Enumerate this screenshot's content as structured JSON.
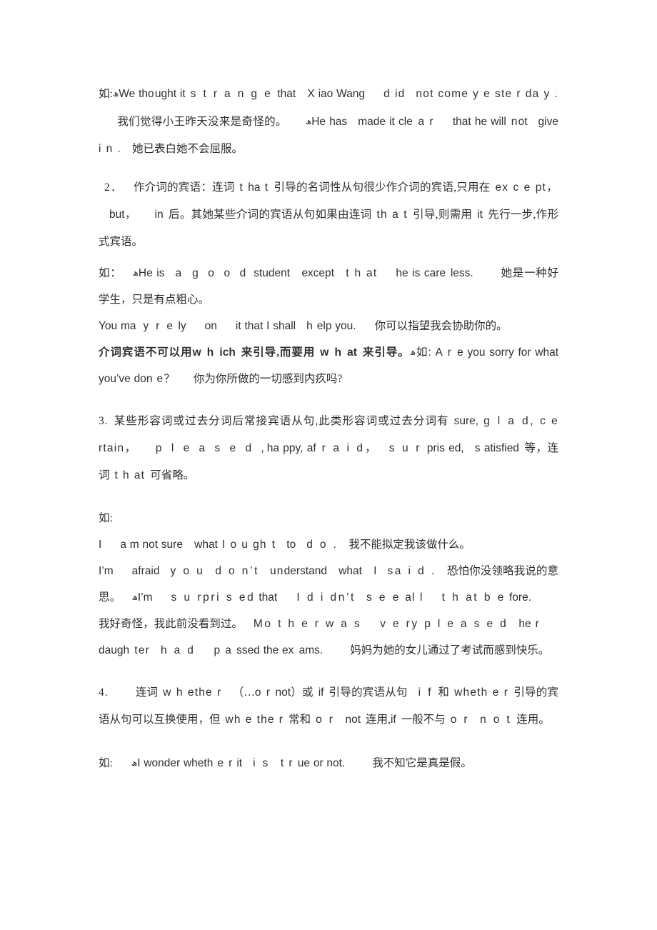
{
  "document": {
    "language": "zh-CN / en",
    "page_background": "#ffffff",
    "text_color": "#2f2f2f",
    "marker_glyph": "ھ"
  },
  "blocks": [
    {
      "id": "example-block-1",
      "kind": "example-paragraph",
      "runs": [
        {
          "text": "如:",
          "style": "cjk"
        },
        {
          "text": "ھ",
          "style": "marker"
        },
        {
          "text": "We th",
          "style": "sans"
        },
        {
          "text": "o",
          "style": "sans-track2"
        },
        {
          "text": "ught it",
          "style": "sans"
        },
        {
          "text": "  s t r a n g e ",
          "style": "sans-track3"
        },
        {
          "text": "tha",
          "style": "sans"
        },
        {
          "text": "t",
          "style": "sans-track2"
        },
        {
          "text": "   X iao Wang",
          "style": "sans"
        },
        {
          "text": "    d id    no",
          "style": "sans-track2"
        },
        {
          "text": "t",
          "style": "sans"
        },
        {
          "text": "  come y e ste r da y .",
          "style": "sans-track2"
        },
        {
          "text": "    我们觉得小王昨天没来是奇怪的。",
          "style": "cjk"
        },
        {
          "text": "   ",
          "style": "sans"
        },
        {
          "text": "ھ",
          "style": "marker"
        },
        {
          "text": "He has   made it cl e a r    that he will  n ot   give i n .",
          "style": "sans"
        },
        {
          "text": "   她已表白她不会屈服。",
          "style": "cjk"
        }
      ],
      "plain_text": "如:ھWe thought it strange that Xiao Wang did not come yesterday. 我们觉得小王昨天没来是奇怪的。 ھHe has made it clear that he will not give in. 她已表白她不会屈服。"
    },
    {
      "id": "item-2",
      "kind": "numbered-item",
      "number": "2．",
      "plain_text": "2． 作介词的宾语：连词 that 引导的名词性从句很少作介词的宾语,只用在 except, but, in 后。其她某些介词的宾语从句如果由连词 that 引导,则需用 it 先行一步,作形式宾语。",
      "runs": [
        {
          "text": "2．",
          "style": "num"
        },
        {
          "text": "  作介词的宾语：连词 ",
          "style": "cjk"
        },
        {
          "text": "t ",
          "style": "sans-track2"
        },
        {
          "text": "ha",
          "style": "sans"
        },
        {
          "text": " t",
          "style": "sans-track2"
        },
        {
          "text": " 引导的名词性从句很少作介词的宾语,只用在 ",
          "style": "cjk"
        },
        {
          "text": "ex c e pt，",
          "style": "sans"
        },
        {
          "text": "  but，",
          "style": "sans"
        },
        {
          "text": "   in",
          "style": "sans"
        },
        {
          "text": " 后。其她某些介词的宾语从句如果由连词 ",
          "style": "cjk"
        },
        {
          "text": "th a t",
          "style": "sans"
        },
        {
          "text": " 引导,则需用 ",
          "style": "cjk"
        },
        {
          "text": "it",
          "style": "sans"
        },
        {
          "text": " 先行一步,作形式宾语。",
          "style": "cjk"
        }
      ]
    },
    {
      "id": "example-block-2",
      "kind": "example-paragraph",
      "plain_text": "如： ھHe is a good student except that he is careless. 她是一种好学生，只是有点粗心。",
      "runs": [
        {
          "text": "如：",
          "style": "cjk"
        },
        {
          "text": "  ",
          "style": "sans"
        },
        {
          "text": "ھ",
          "style": "marker"
        },
        {
          "text": "He is",
          "style": "sans"
        },
        {
          "text": "  a  ",
          "style": "sans"
        },
        {
          "text": "g o o d",
          "style": "sans-track3"
        },
        {
          "text": "  studen",
          "style": "sans"
        },
        {
          "text": "t",
          "style": "sans-track2"
        },
        {
          "text": "  excep",
          "style": "sans"
        },
        {
          "text": "t   t h at",
          "style": "sans-track2"
        },
        {
          "text": "   he is car",
          "style": "sans"
        },
        {
          "text": "e",
          "style": "sans-track2"
        },
        {
          "text": " less.",
          "style": "sans"
        },
        {
          "text": "    她是一种好学生，只是有点粗心。",
          "style": "cjk"
        }
      ]
    },
    {
      "id": "example-line-rely",
      "kind": "example-line",
      "plain_text": "You may rely on it that I shall help you. 你可以指望我会协助你的。",
      "runs": [
        {
          "text": "You m",
          "style": "sans"
        },
        {
          "text": "a y r e",
          "style": "sans-track3"
        },
        {
          "text": " ly",
          "style": "sans"
        },
        {
          "text": "   on",
          "style": "sans"
        },
        {
          "text": "   it that I shall",
          "style": "sans"
        },
        {
          "text": "  h",
          "style": "sans-track2"
        },
        {
          "text": " elp you.",
          "style": "sans"
        },
        {
          "text": "   你可以指望我会协助你的。",
          "style": "cjk"
        }
      ]
    },
    {
      "id": "rule-bold-line",
      "kind": "bold-rule",
      "plain_text": "介词宾语不可以用which来引导,而要用what来引导。ھ如: Are you sorry for what you've done？ 你为你所做的一切感到内疚吗?",
      "runs": [
        {
          "text": "介词宾语不可以用",
          "style": "cjk-bold"
        },
        {
          "text": "w h ",
          "style": "sans-bold-track2"
        },
        {
          "text": "ich",
          "style": "sans-bold"
        },
        {
          "text": " 来引导,而要用 ",
          "style": "cjk-bold"
        },
        {
          "text": "w h ",
          "style": "sans-bold-track2"
        },
        {
          "text": "at",
          "style": "sans-bold"
        },
        {
          "text": " 来引导。",
          "style": "cjk-bold"
        },
        {
          "text": "ھ",
          "style": "marker"
        },
        {
          "text": "如",
          "style": "cjk"
        },
        {
          "text": ": A r e you sorry for what you've don",
          "style": "sans"
        },
        {
          "text": " e",
          "style": "sans-track2"
        },
        {
          "text": " ？",
          "style": "cjk"
        },
        {
          "text": "   你为你所做的一切感到内疚吗?",
          "style": "cjk"
        }
      ]
    },
    {
      "id": "item-3",
      "kind": "numbered-item",
      "number": "3.",
      "plain_text": "3. 某些形容词或过去分词后常接宾语从句,此类形容词或过去分词有 sure, glad, certain, pleased, happy, afraid, surprised, satisfied 等，连词 that 可省略。",
      "runs": [
        {
          "text": "3.",
          "style": "num"
        },
        {
          "text": " 某些形容词或过去分词后常接宾语从句,此类形容词或过去分词有 ",
          "style": "cjk"
        },
        {
          "text": "sure,",
          "style": "sans"
        },
        {
          "text": " g l a d,",
          "style": "sans-track2"
        },
        {
          "text": " c e rtain，",
          "style": "sans-track2"
        },
        {
          "text": "   p l e a s e d ,",
          "style": "sans-track4"
        },
        {
          "text": "ha ppy, af",
          "style": "sans"
        },
        {
          "text": " r a i d，",
          "style": "sans-track3"
        },
        {
          "text": "  s u r pris ed,",
          "style": "sans-track2"
        },
        {
          "text": "  s atisfied",
          "style": "sans"
        },
        {
          "text": " 等，连词 ",
          "style": "cjk"
        },
        {
          "text": "t h at",
          "style": "sans-track2"
        },
        {
          "text": " 可省略。",
          "style": "cjk"
        }
      ]
    },
    {
      "id": "example-intro-ru",
      "kind": "example-line",
      "plain_text": "如:",
      "runs": [
        {
          "text": "如:",
          "style": "cjk"
        }
      ]
    },
    {
      "id": "example-line-sure",
      "kind": "example-line",
      "plain_text": "I am not sure what I ought to do. 我不能拟定我该做什么。",
      "runs": [
        {
          "text": "I",
          "style": "sans"
        },
        {
          "text": "   a m not sur",
          "style": "sans"
        },
        {
          "text": "e",
          "style": "sans-track2"
        },
        {
          "text": "  what",
          "style": "sans"
        },
        {
          "text": " I o u gh",
          "style": "sans-track2"
        },
        {
          "text": " t",
          "style": "sans-track2"
        },
        {
          "text": "  to",
          "style": "sans"
        },
        {
          "text": "  d o .",
          "style": "sans-track2"
        },
        {
          "text": "  我不能拟定我该做什么。",
          "style": "cjk"
        }
      ]
    },
    {
      "id": "example-line-afraid",
      "kind": "example-line",
      "plain_text": "I'm afraid you don't understand what I said. 恐怕你没领略我说的意思。",
      "runs": [
        {
          "text": "I'm",
          "style": "sans"
        },
        {
          "text": "   afraid",
          "style": "sans"
        },
        {
          "text": "  y o u",
          "style": "sans-track3"
        },
        {
          "text": "  d o n't",
          "style": "sans-track2"
        },
        {
          "text": "  un",
          "style": "sans-track2"
        },
        {
          "text": " derstan",
          "style": "sans"
        },
        {
          "text": "d",
          "style": "sans-track2"
        },
        {
          "text": "  wha",
          "style": "sans"
        },
        {
          "text": "t   I   sa i d .",
          "style": "sans-track2"
        },
        {
          "text": "  恐怕你没领略我说的意思。",
          "style": "cjk"
        }
      ]
    },
    {
      "id": "example-line-surprised",
      "kind": "example-line",
      "plain_text": "ھI'm surprised that I didn't see all that before. 我好奇怪，我此前没看到过。 Mother was very pleased her daughter had passed the exams. 妈妈为她的女儿通过了考试而感到快乐。",
      "runs": [
        {
          "text": "ھ",
          "style": "marker"
        },
        {
          "text": "I'm",
          "style": "sans"
        },
        {
          "text": "   s u rpri s ed",
          "style": "sans-track2"
        },
        {
          "text": " tha",
          "style": "sans"
        },
        {
          "text": "t",
          "style": "sans-track2"
        },
        {
          "text": "   I d i dn't",
          "style": "sans-track2"
        },
        {
          "text": "  s e e",
          "style": "sans-track2"
        },
        {
          "text": " al l",
          "style": "sans-track2"
        },
        {
          "text": "   t h at b e fore.",
          "style": "sans-track2"
        },
        {
          "text": "    我好奇怪，我此前没看到过。",
          "style": "cjk"
        },
        {
          "text": "  Mo t h e r w a s",
          "style": "sans-track3"
        },
        {
          "text": "   v e ry p l e a s e d",
          "style": "sans-track3"
        },
        {
          "text": "  he",
          "style": "sans"
        },
        {
          "text": " r",
          "style": "sans-track2"
        },
        {
          "text": "   daug",
          "style": "sans"
        },
        {
          "text": "h ter",
          "style": "sans-track2"
        },
        {
          "text": "  h a d",
          "style": "sans-track3"
        },
        {
          "text": "   p a ssed the e",
          "style": "sans-track2"
        },
        {
          "text": "x ams.",
          "style": "sans"
        },
        {
          "text": "    妈妈为她的女儿通过了考试而感到快乐。",
          "style": "cjk"
        }
      ]
    },
    {
      "id": "item-4",
      "kind": "numbered-item",
      "number": "4.",
      "plain_text": "4. 连词 whether （…or not）或 if 引导的宾语从句 if 和 whether 引导的宾语从句可以互换使用，但 whether 常和 or not 连用,if 一般不与 or not 连用。",
      "runs": [
        {
          "text": "4.",
          "style": "num"
        },
        {
          "text": "   连词 ",
          "style": "cjk"
        },
        {
          "text": "w h ethe",
          "style": "sans-track2"
        },
        {
          "text": " r",
          "style": "sans-track2"
        },
        {
          "text": "  （…",
          "style": "cjk"
        },
        {
          "text": "o r not",
          "style": "sans-track2"
        },
        {
          "text": "）或 ",
          "style": "cjk"
        },
        {
          "text": "if",
          "style": "sans"
        },
        {
          "text": " 引导的宾语从句  ",
          "style": "cjk"
        },
        {
          "text": "i f",
          "style": "sans-track3"
        },
        {
          "text": " 和 ",
          "style": "cjk"
        },
        {
          "text": "wheth e r",
          "style": "sans-track2"
        },
        {
          "text": " 引导的宾语从句可以互换使用，但 ",
          "style": "cjk"
        },
        {
          "text": "wh e the r",
          "style": "sans-track2"
        },
        {
          "text": " 常和 ",
          "style": "cjk"
        },
        {
          "text": "o r   not",
          "style": "sans-track2"
        },
        {
          "text": " 连用,",
          "style": "cjk"
        },
        {
          "text": "if",
          "style": "sans"
        },
        {
          "text": " 一般不与 ",
          "style": "cjk"
        },
        {
          "text": "o r   n o t",
          "style": "sans-track3"
        },
        {
          "text": " 连用。",
          "style": "cjk"
        }
      ]
    },
    {
      "id": "example-block-wonder",
      "kind": "example-paragraph",
      "plain_text": "如: ھI wonder whether it is true or not. 我不知它是真是假。",
      "runs": [
        {
          "text": "如:",
          "style": "cjk"
        },
        {
          "text": "   ",
          "style": "sans"
        },
        {
          "text": "ھ",
          "style": "marker"
        },
        {
          "text": "I wonder wheth",
          "style": "sans"
        },
        {
          "text": " e r",
          "style": "sans-track2"
        },
        {
          "text": " it",
          "style": "sans"
        },
        {
          "text": "  i s",
          "style": "sans-track3"
        },
        {
          "text": "  t r ue or not.",
          "style": "sans-track2"
        },
        {
          "text": "    我不知它是真是假。",
          "style": "cjk"
        }
      ]
    }
  ]
}
